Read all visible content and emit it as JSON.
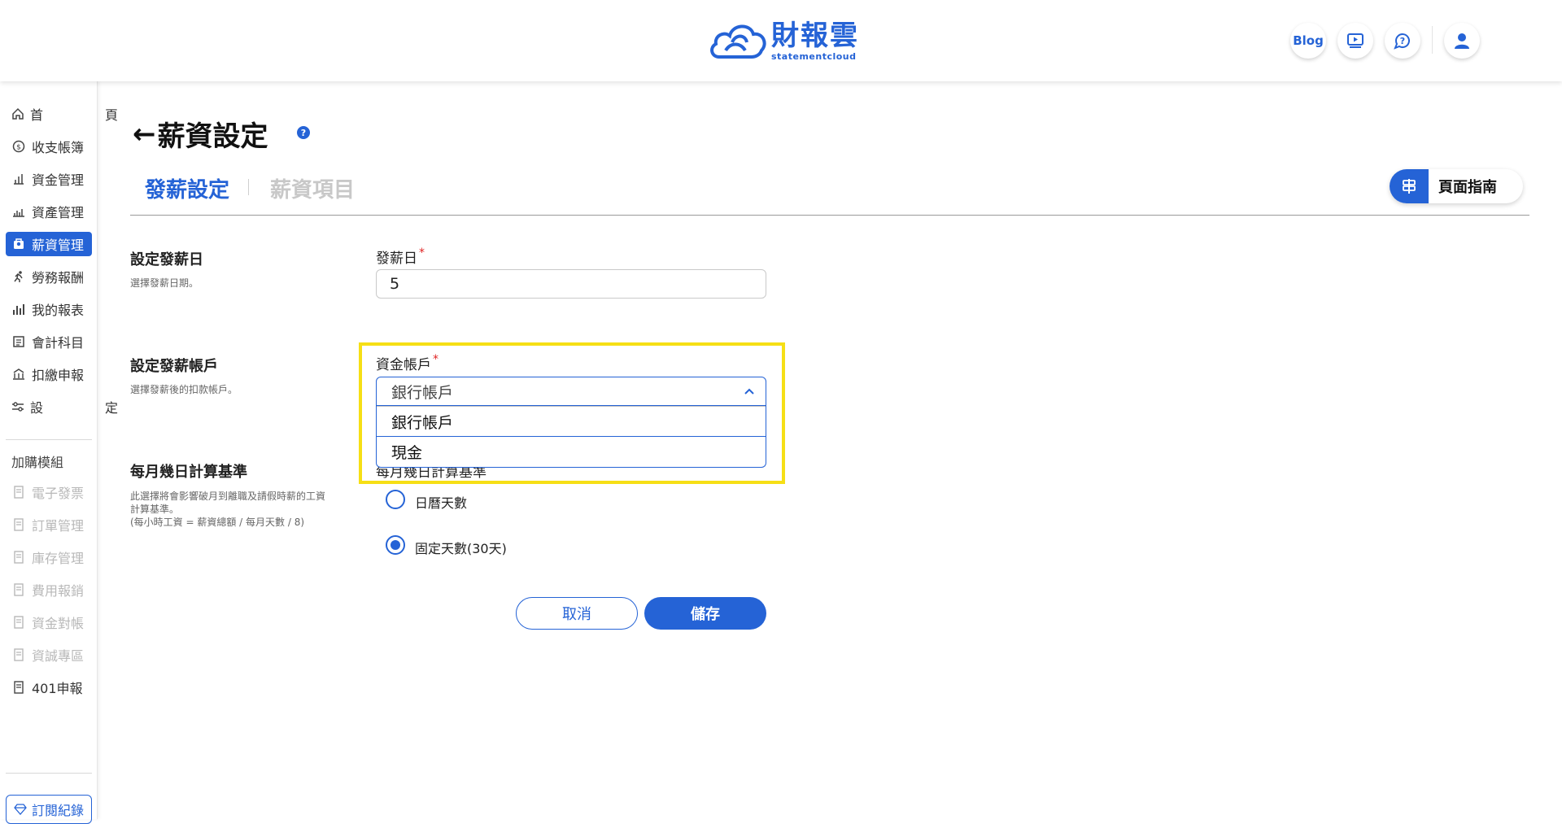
{
  "brand": {
    "name": "財報雲",
    "sub": "statementcloud",
    "color": "#2563d6"
  },
  "header": {
    "blog_label": "Blog",
    "icons": [
      "video-tutorial-icon",
      "help-chat-icon",
      "user-icon"
    ]
  },
  "sidebar": {
    "items": [
      {
        "label": "首　頁",
        "icon": "home-icon"
      },
      {
        "label": "收支帳簿",
        "icon": "coin-icon"
      },
      {
        "label": "資金管理",
        "icon": "fund-icon"
      },
      {
        "label": "資產管理",
        "icon": "asset-icon"
      },
      {
        "label": "薪資管理",
        "icon": "payroll-icon",
        "active": true
      },
      {
        "label": "勞務報酬",
        "icon": "runner-icon"
      },
      {
        "label": "我的報表",
        "icon": "report-chart-icon"
      },
      {
        "label": "會計科目",
        "icon": "ledger-icon"
      },
      {
        "label": "扣繳申報",
        "icon": "tax-icon"
      },
      {
        "label": "設　定",
        "icon": "settings-sliders-icon"
      }
    ],
    "addon_title": "加購模組",
    "addons": [
      {
        "label": "電子發票",
        "disabled": true
      },
      {
        "label": "訂單管理",
        "disabled": true
      },
      {
        "label": "庫存管理",
        "disabled": true
      },
      {
        "label": "費用報銷",
        "disabled": true
      },
      {
        "label": "資金對帳",
        "disabled": true
      },
      {
        "label": "資誠專區",
        "disabled": true
      },
      {
        "label": "401申報",
        "disabled": false
      }
    ],
    "subscription_label": "訂閱紀錄"
  },
  "page": {
    "title": "薪資設定",
    "tabs": [
      {
        "label": "發薪設定",
        "active": true
      },
      {
        "label": "薪資項目",
        "active": false
      }
    ],
    "guide_label": "頁面指南"
  },
  "sections": {
    "payday": {
      "title": "設定發薪日",
      "desc": "選擇發薪日期。",
      "field_label": "發薪日",
      "value": "5"
    },
    "account": {
      "title": "設定發薪帳戶",
      "desc": "選擇發薪後的扣款帳戶。",
      "field_label": "資金帳戶",
      "selected": "銀行帳戶",
      "options": [
        "銀行帳戶",
        "現金"
      ]
    },
    "basis": {
      "title": "每月幾日計算基準",
      "desc_lines": [
        "此選擇將會影響破月到離職及請假時薪的工資",
        "計算基準。",
        "(每小時工資 = 薪資總額 / 每月天數 / 8)"
      ],
      "field_label": "每月幾日計算基準",
      "options": [
        {
          "label": "日曆天數",
          "checked": false
        },
        {
          "label": "固定天數(30天)",
          "checked": true
        }
      ]
    }
  },
  "actions": {
    "cancel": "取消",
    "save": "儲存"
  }
}
